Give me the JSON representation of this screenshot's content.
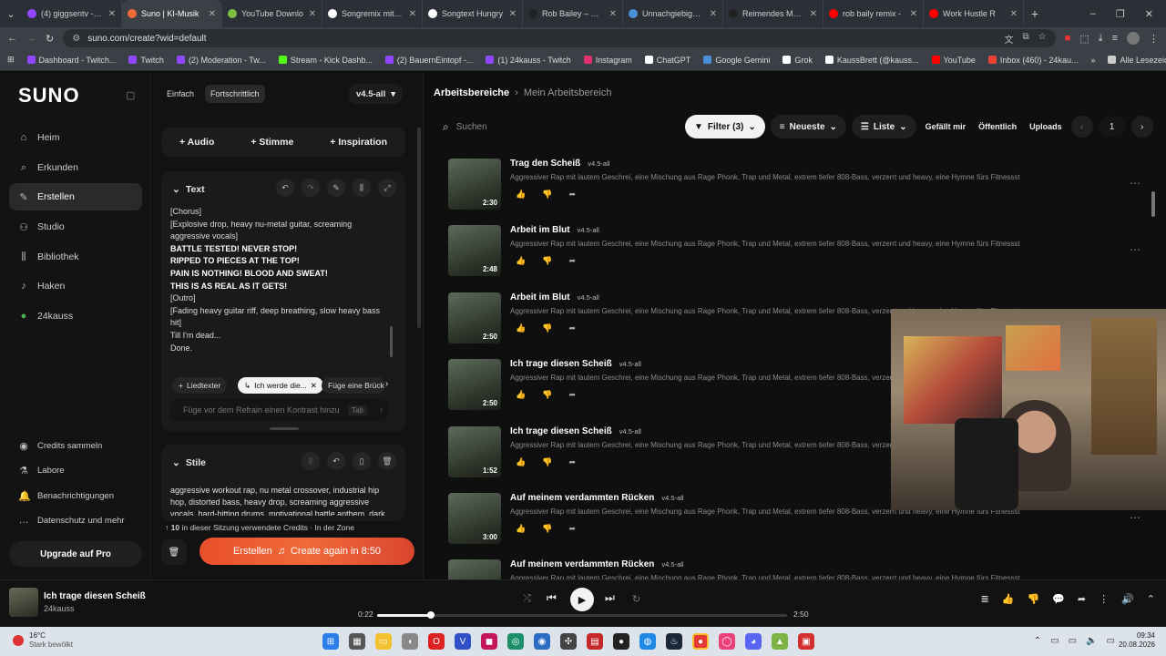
{
  "browser": {
    "tabs": [
      {
        "label": "(4) giggsentv - Tw",
        "color": "#9146ff",
        "active": false
      },
      {
        "label": "Suno | KI-Musik",
        "color": "#f06a3a",
        "active": true
      },
      {
        "label": "YouTube Downlo",
        "color": "#7bc043",
        "active": false
      },
      {
        "label": "Songremix mit Ele",
        "color": "#ffffff",
        "active": false
      },
      {
        "label": "Songtext Hungry",
        "color": "#ffffff",
        "active": false
      },
      {
        "label": "Rob Bailey – Hung",
        "color": "#222222",
        "active": false
      },
      {
        "label": "Unnachgiebiger R",
        "color": "#4a90d9",
        "active": false
      },
      {
        "label": "Reimendes Motiv",
        "color": "#222222",
        "active": false
      },
      {
        "label": "rob baily remix -",
        "color": "#ff0000",
        "active": false
      },
      {
        "label": "Work Hustle R",
        "color": "#ff0000",
        "active": false
      }
    ],
    "url": "suno.com/create?wid=default",
    "bookmarks": [
      {
        "label": "Dashboard - Twitch...",
        "color": "#9146ff"
      },
      {
        "label": "Twitch",
        "color": "#9146ff"
      },
      {
        "label": "(2) Moderation - Tw...",
        "color": "#9146ff"
      },
      {
        "label": "Stream - Kick Dashb...",
        "color": "#53fc18"
      },
      {
        "label": "(2) BauernEintopf -...",
        "color": "#9146ff"
      },
      {
        "label": "(1) 24kauss - Twitch",
        "color": "#9146ff"
      },
      {
        "label": "Instagram",
        "color": "#e1306c"
      },
      {
        "label": "ChatGPT",
        "color": "#ffffff"
      },
      {
        "label": "Google Gemini",
        "color": "#4a90d9"
      },
      {
        "label": "Grok",
        "color": "#ffffff"
      },
      {
        "label": "KaussBrett (@kauss...",
        "color": "#ffffff"
      },
      {
        "label": "YouTube",
        "color": "#ff0000"
      },
      {
        "label": "Inbox (460) - 24kau...",
        "color": "#ea4335"
      }
    ],
    "all_bookmarks": "Alle Lesezeichen"
  },
  "sidebar": {
    "logo": "SUNO",
    "items": [
      {
        "label": "Heim",
        "icon": "home-icon",
        "glyph": "⌂"
      },
      {
        "label": "Erkunden",
        "icon": "search-icon",
        "glyph": "⌕"
      },
      {
        "label": "Erstellen",
        "icon": "create-icon",
        "glyph": "✎"
      },
      {
        "label": "Studio",
        "icon": "studio-icon",
        "glyph": "⚇"
      },
      {
        "label": "Bibliothek",
        "icon": "library-icon",
        "glyph": "⫼"
      },
      {
        "label": "Haken",
        "icon": "hook-icon",
        "glyph": "♪"
      },
      {
        "label": "24kauss",
        "icon": "avatar-icon",
        "glyph": "●"
      }
    ],
    "bottom_items": [
      {
        "label": "Credits sammeln",
        "icon": "credits-icon",
        "glyph": "◉"
      },
      {
        "label": "Labore",
        "icon": "labs-icon",
        "glyph": "⚗"
      },
      {
        "label": "Benachrichtigungen",
        "icon": "bell-icon",
        "glyph": "🔔"
      },
      {
        "label": "Datenschutz und mehr",
        "icon": "more-icon",
        "glyph": "…"
      }
    ],
    "upgrade": "Upgrade auf Pro"
  },
  "create": {
    "mode_simple": "Einfach",
    "mode_advanced": "Fortschrittlich",
    "model": "v4.5-all",
    "add_audio": "Audio",
    "add_voice": "Stimme",
    "add_inspiration": "Inspiration",
    "text_header": "Text",
    "lyrics": [
      {
        "t": "[Chorus]",
        "b": false
      },
      {
        "t": "[Explosive drop, heavy nu-metal guitar, screaming aggressive vocals]",
        "b": false
      },
      {
        "t": "BATTLE TESTED! NEVER STOP!",
        "b": true
      },
      {
        "t": "RIPPED TO PIECES AT THE TOP!",
        "b": true
      },
      {
        "t": "PAIN IS NOTHING! BLOOD AND SWEAT!",
        "b": true
      },
      {
        "t": "THIS IS AS REAL AS IT GETS!",
        "b": true
      },
      {
        "t": " ",
        "b": false
      },
      {
        "t": "[Outro]",
        "b": false
      },
      {
        "t": "[Fading heavy guitar riff, deep breathing, slow heavy bass hit]",
        "b": false
      },
      {
        "t": "Till I'm dead...",
        "b": false
      },
      {
        "t": "Done.",
        "b": false
      }
    ],
    "chip_lyricist": "Liedtexter",
    "chip_active": "Ich werde die...",
    "chip_bridge": "Füge eine Brück",
    "prompt_placeholder": "Füge vor dem Refrain einen Kontrast hinzu",
    "prompt_key": "Tab",
    "styles_header": "Stile",
    "styles_text": "aggressive workout rap, nu metal crossover, industrial hip hop, distorted bass, heavy drop, screaming aggressive vocals, hard-hitting drums, motivational battle anthem, dark",
    "credits_count": "10",
    "credits_text": "in dieser Sitzung verwendete Credits",
    "credits_zone": "· In der Zone",
    "create_label": "Erstellen",
    "create_again": "Create again in 8:50"
  },
  "workspace": {
    "crumb_root": "Arbeitsbereiche",
    "crumb_current": "Mein Arbeitsbereich",
    "search_placeholder": "Suchen",
    "filter": "Filter (3)",
    "sort": "Neueste",
    "view": "Liste",
    "liked": "Gefällt mir",
    "public": "Öffentlich",
    "uploads": "Uploads",
    "page": "1",
    "songs": [
      {
        "title": "Trag den Scheiß",
        "version": "v4.5-all",
        "duration": "2:30",
        "desc": "Aggressiver Rap mit lautem Geschrei, eine Mischung aus Rage Phonk, Trap und Metal, extrem tiefer 808-Bass, verzerrt und heavy, eine Hymne fürs Fitnessstudio, roh."
      },
      {
        "title": "Arbeit im Blut",
        "version": "v4.5-all",
        "duration": "2:48",
        "desc": "Aggressiver Rap mit lautem Geschrei, eine Mischung aus Rage Phonk, Trap und Metal, extrem tiefer 808-Bass, verzerrt und heavy, eine Hymne fürs Fitnessstudio, roh."
      },
      {
        "title": "Arbeit im Blut",
        "version": "v4.5-all",
        "duration": "2:50",
        "desc": "Aggressiver Rap mit lautem Geschrei, eine Mischung aus Rage Phonk, Trap und Metal, extrem tiefer 808-Bass, verzerrt und heavy, eine Hymne fürs Fitnessstudio, roh."
      },
      {
        "title": "Ich trage diesen Scheiß",
        "version": "v4.5-all",
        "duration": "2:50",
        "desc": "Aggressiver Rap mit lautem Geschrei, eine Mischung aus Rage Phonk, Trap und Metal, extrem tiefer 808-Bass, verzerrt und heavy, eine Hymne fürs Fitnessstudio, roh."
      },
      {
        "title": "Ich trage diesen Scheiß",
        "version": "v4.5-all",
        "duration": "1:52",
        "desc": "Aggressiver Rap mit lautem Geschrei, eine Mischung aus Rage Phonk, Trap und Metal, extrem tiefer 808-Bass, verzerrt und heavy, eine Hymne fürs Fitnessstudio, roh."
      },
      {
        "title": "Auf meinem verdammten Rücken",
        "version": "v4.5-all",
        "duration": "3:00",
        "desc": "Aggressiver Rap mit lautem Geschrei, eine Mischung aus Rage Phonk, Trap und Metal, extrem tiefer 808-Bass, verzerrt und heavy, eine Hymne fürs Fitnessstudio, roh."
      },
      {
        "title": "Auf meinem verdammten Rücken",
        "version": "v4.5-all",
        "duration": "",
        "desc": "Aggressiver Rap mit lautem Geschrei, eine Mischung aus Rage Phonk, Trap und Metal, extrem tiefer 808-Bass, verzerrt und heavy, eine Hymne fürs Fitnessstudio, roh."
      }
    ]
  },
  "player": {
    "title": "Ich trage diesen Scheiß",
    "artist": "24kauss",
    "current": "0:22",
    "total": "2:50",
    "progress": 0.13
  },
  "taskbar": {
    "weather_temp": "16°C",
    "weather_desc": "Stark bewölkt",
    "time": "09:34",
    "date": "20.08.2026"
  }
}
